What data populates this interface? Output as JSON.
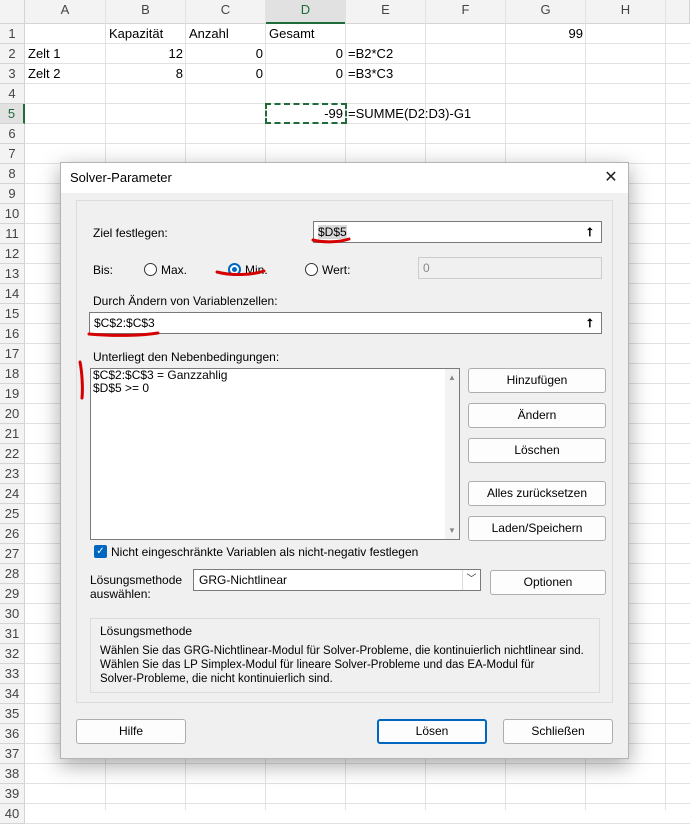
{
  "sheet": {
    "columns": [
      "A",
      "B",
      "C",
      "D",
      "E",
      "F",
      "G",
      "H"
    ],
    "rows": [
      "1",
      "2",
      "3",
      "4",
      "5",
      "6",
      "7",
      "8",
      "9",
      "10",
      "11",
      "12",
      "13",
      "14",
      "15",
      "16",
      "17",
      "18",
      "19",
      "20",
      "21",
      "22",
      "23",
      "24",
      "25",
      "26",
      "27",
      "28",
      "29",
      "30",
      "31",
      "32",
      "33",
      "34",
      "35",
      "36",
      "37",
      "38",
      "39",
      "40"
    ],
    "cells": {
      "B1": "Kapazität",
      "C1": "Anzahl",
      "D1": "Gesamt",
      "G1": "99",
      "A2": "Zelt 1",
      "B2": "12",
      "C2": "0",
      "D2": "0",
      "E2": "=B2*C2",
      "A3": "Zelt 2",
      "B3": "8",
      "C3": "0",
      "D3": "0",
      "E3": "=B3*C3",
      "D5": "-99",
      "E5": "=SUMME(D2:D3)-G1"
    }
  },
  "dialog": {
    "title": "Solver-Parameter",
    "close_icon": "close-icon",
    "objective_label": "Ziel festlegen:",
    "objective_value": "$D$5",
    "to_label": "Bis:",
    "radio_max": "Max.",
    "radio_min": "Min.",
    "radio_value": "Wert:",
    "value_field": "0",
    "selected_option": "Min.",
    "variables_label": "Durch Ändern von Variablenzellen:",
    "variables_value": "$C$2:$C$3",
    "constraints_label": "Unterliegt den Nebenbedingungen:",
    "constraints": [
      "$C$2:$C$3 = Ganzzahlig",
      "$D$5 >= 0"
    ],
    "buttons": {
      "add": "Hinzufügen",
      "change": "Ändern",
      "delete": "Löschen",
      "reset_all": "Alles zurücksetzen",
      "load_save": "Laden/Speichern",
      "options": "Optionen",
      "help": "Hilfe",
      "solve": "Lösen",
      "close": "Schließen"
    },
    "nonneg_checkbox": "Nicht eingeschränkte Variablen als nicht-negativ festlegen",
    "nonneg_checked": true,
    "method_label_1": "Lösungsmethode",
    "method_label_2": "auswählen:",
    "method_selected": "GRG-Nichtlinear",
    "desc_title": "Lösungsmethode",
    "desc_text_1": "Wählen Sie das GRG-Nichtlinear-Modul für Solver-Probleme, die kontinuierlich nichtlinear sind.",
    "desc_text_2": "Wählen Sie das LP Simplex-Modul für lineare Solver-Probleme und das EA-Modul für",
    "desc_text_3": "Solver-Probleme, die nicht kontinuierlich sind."
  },
  "colors": {
    "accent": "#0067c0",
    "excel_green": "#1f6b3a",
    "annotation": "#d60000"
  }
}
